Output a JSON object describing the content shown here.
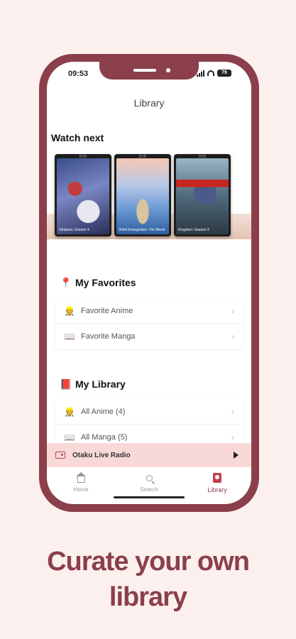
{
  "status_bar": {
    "time": "09:53",
    "battery": "79"
  },
  "app": {
    "title": "Library"
  },
  "watch_next": {
    "title": "Watch next",
    "dvd_tag": "DVD",
    "items": [
      {
        "label": "Gintama: Season 4"
      },
      {
        "label": "Violet Evergarden: The Movie"
      },
      {
        "label": "Kingdom: Season 3"
      }
    ]
  },
  "favorites": {
    "icon": "pin-icon",
    "title": "My Favorites",
    "items": [
      {
        "label": "Favorite Anime",
        "icon": "person-icon"
      },
      {
        "label": "Favorite Manga",
        "icon": "book-icon"
      }
    ]
  },
  "library": {
    "icon": "notebook-icon",
    "title": "My Library",
    "items": [
      {
        "label": "All Anime (4)",
        "icon": "person-icon"
      },
      {
        "label": "All Manga (5)",
        "icon": "book-icon"
      }
    ]
  },
  "radio": {
    "label": "Otaku Live Radio"
  },
  "tabs": [
    {
      "label": "Home",
      "icon": "home-icon"
    },
    {
      "label": "Search",
      "icon": "search-icon"
    },
    {
      "label": "Library",
      "icon": "library-icon"
    }
  ],
  "tagline": {
    "line1": "Curate your own",
    "line2": "library"
  },
  "colors": {
    "brand": "#8b3f4a",
    "background": "#fbf0ee",
    "radio_bar": "#f8d9d8"
  }
}
